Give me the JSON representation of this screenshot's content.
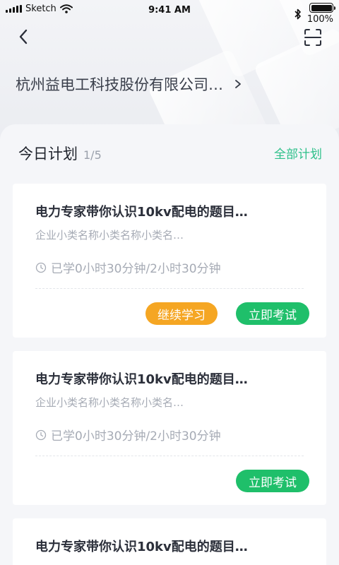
{
  "status_bar": {
    "carrier": "Sketch",
    "time": "9:41 AM",
    "battery": "100%"
  },
  "header": {
    "company": "杭州益电工科技股份有限公司…"
  },
  "plan": {
    "title": "今日计划",
    "count": "1/5",
    "all_link": "全部计划"
  },
  "cards": [
    {
      "title": "电力专家带你认识10kv配电的题目…",
      "subtitle": "企业小类名称小类名称小类名…",
      "time": "已学0小时30分钟/2小时30分钟",
      "continue_label": "继续学习",
      "exam_label": "立即考试"
    },
    {
      "title": "电力专家带你认识10kv配电的题目…",
      "subtitle": "企业小类名称小类名称小类名…",
      "time": "已学0小时30分钟/2小时30分钟",
      "exam_label": "立即考试"
    },
    {
      "title": "电力专家带你认识10kv配电的题目…"
    }
  ],
  "colors": {
    "accent_green": "#1fbf6a",
    "link_green": "#2ec08a",
    "continue_orange": "#f5a623"
  }
}
